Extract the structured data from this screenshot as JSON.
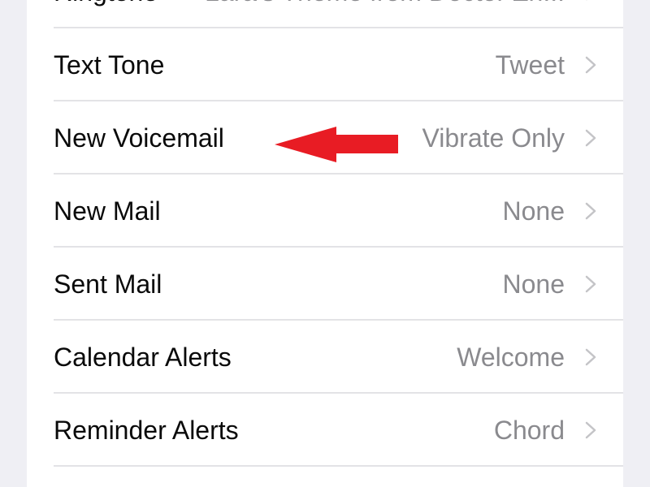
{
  "settings_list": {
    "rows": [
      {
        "label": "Ringtone",
        "value": "Lara's Theme from Doctor Zh..."
      },
      {
        "label": "Text Tone",
        "value": "Tweet"
      },
      {
        "label": "New Voicemail",
        "value": "Vibrate Only"
      },
      {
        "label": "New Mail",
        "value": "None"
      },
      {
        "label": "Sent Mail",
        "value": "None"
      },
      {
        "label": "Calendar Alerts",
        "value": "Welcome"
      },
      {
        "label": "Reminder Alerts",
        "value": "Chord"
      }
    ]
  },
  "annotation": {
    "icon": "left-arrow",
    "target_row": "New Voicemail",
    "color": "#e81c24"
  },
  "colors": {
    "background": "#efeff4",
    "card": "#ffffff",
    "label": "#0a0a0a",
    "value": "#8a8a8e",
    "chevron": "#c4c4c7",
    "divider": "#e3e3e6"
  }
}
